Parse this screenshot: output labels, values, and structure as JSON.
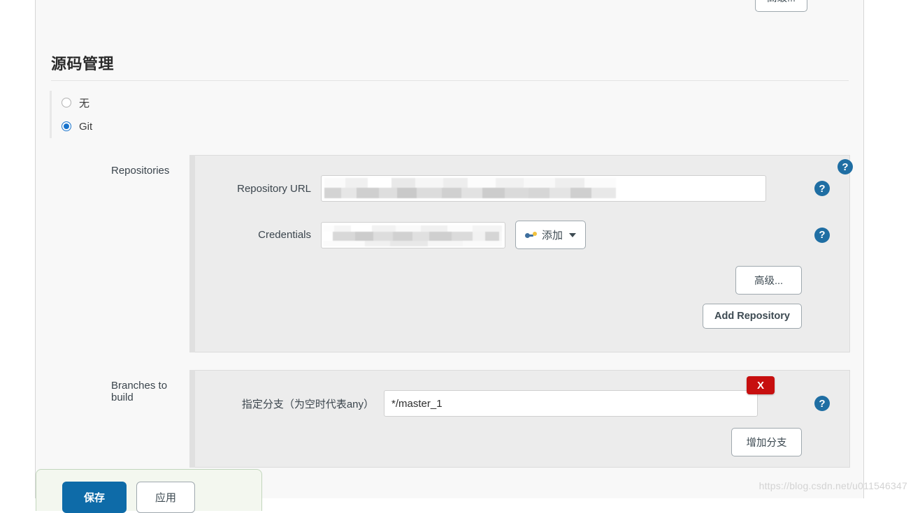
{
  "page": {
    "watermark": "https://blog.csdn.net/u011546347"
  },
  "top_bar": {
    "advanced_label": "高级..."
  },
  "section": {
    "title": "源码管理"
  },
  "scm_options": [
    {
      "label": "无",
      "checked": false
    },
    {
      "label": "Git",
      "checked": true
    }
  ],
  "repositories": {
    "row_label": "Repositories",
    "help_icon": "help-circle-icon",
    "repository_url": {
      "label": "Repository URL",
      "value": "",
      "redacted": true,
      "help_icon": "help-circle-icon"
    },
    "credentials": {
      "label": "Credentials",
      "value": "",
      "redacted": true,
      "help_icon": "help-circle-icon",
      "add_button": {
        "label": "添加",
        "icon": "key-icon",
        "caret": "chevron-down-icon"
      }
    },
    "advanced_label": "高级...",
    "add_repository_label": "Add Repository"
  },
  "branches": {
    "row_label": "Branches to build",
    "specifier": {
      "label": "指定分支（为空时代表any）",
      "value": "*/master_1",
      "placeholder": "*/master",
      "help_icon": "help-circle-icon",
      "delete_label": "X"
    },
    "add_branch_label": "增加分支"
  },
  "save_bar": {
    "save_label": "保存",
    "apply_label": "应用"
  },
  "colors": {
    "accent_blue": "#1873cc",
    "help_blue": "#1f6ea3",
    "primary_button": "#0e6ba8",
    "danger_red": "#c70f0f",
    "panel_bg": "#ececec",
    "page_bg": "#f8f8f8"
  }
}
